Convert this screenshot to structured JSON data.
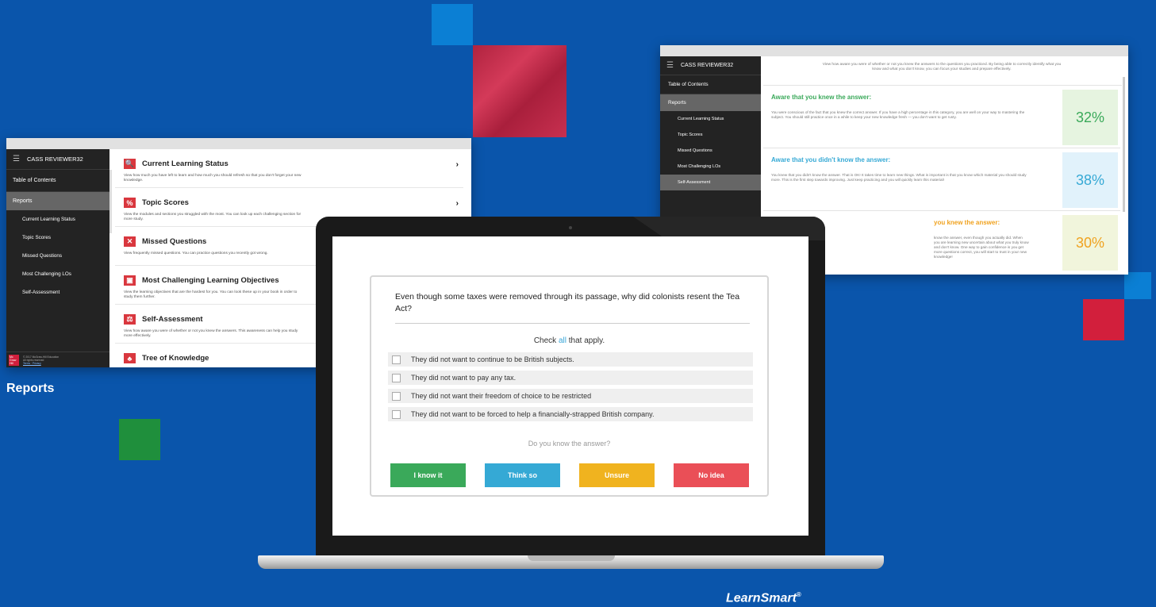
{
  "colors": {
    "background": "#0a55ab",
    "know_it": "#3aa95a",
    "think_so": "#35a9d5",
    "unsure": "#f0b31f",
    "no_idea": "#ea4f57",
    "icon_red": "#d9373e"
  },
  "left_screen": {
    "app_title": "CASS REVIEWER32",
    "sidebar": {
      "toc": "Table of Contents",
      "reports": "Reports",
      "items": [
        "Current Learning Status",
        "Topic Scores",
        "Missed Questions",
        "Most Challenging LOs",
        "Self-Assessment"
      ],
      "footer_lines": [
        "© 2017 McGraw-Hill Education",
        "All rights reserved"
      ],
      "footer_links": "Terms · Privacy",
      "logo_text": "Mc Graw Hill"
    },
    "reports": [
      {
        "icon": "search-icon",
        "glyph": "🔍",
        "title": "Current Learning Status",
        "desc": "View how much you have left to learn and how much you should refresh so that you don't forget your new knowledge."
      },
      {
        "icon": "percent-icon",
        "glyph": "%",
        "title": "Topic Scores",
        "desc": "View the modules and sections you struggled with the most. You can look up each challenging section for more study."
      },
      {
        "icon": "x-icon",
        "glyph": "✕",
        "title": "Missed Questions",
        "desc": "View frequently missed questions. You can practice questions you recently got wrong."
      },
      {
        "icon": "book-icon",
        "glyph": "▣",
        "title": "Most Challenging Learning Objectives",
        "desc": "View the learning objectives that are the hardest for you. You can look these up in your book in order to study them further."
      },
      {
        "icon": "scale-icon",
        "glyph": "⚖",
        "title": "Self-Assessment",
        "desc": "View how aware you were of whether or not you knew the answers. This awareness can help you study more effectively."
      },
      {
        "icon": "tree-icon",
        "glyph": "♣",
        "title": "Tree of Knowledge",
        "desc": ""
      }
    ]
  },
  "right_screen": {
    "app_title": "CASS REVIEWER32",
    "sidebar": {
      "toc": "Table of Contents",
      "reports": "Reports",
      "items": [
        "Current Learning Status",
        "Topic Scores",
        "Missed Questions",
        "Most Challenging LOs",
        "Self-Assessment"
      ]
    },
    "intro": "View how aware you were of whether or not you knew the answers to the questions you practiced. By being able to correctly identify what you know and what you don't know, you can focus your studies and prepare effectively.",
    "rows": [
      {
        "title": "Aware that you knew the answer:",
        "color": "#3aa95a",
        "bg": "#e6f4e0",
        "percent": "32%",
        "desc": "You were conscious of the fact that you knew the correct answer. If you have a high percentage in this category, you are well on your way to mastering the subject. You should still practice once in a while to keep your new knowledge fresh — you don't want to get rusty."
      },
      {
        "title": "Aware that you didn't know the answer:",
        "color": "#35a9d5",
        "bg": "#e1f2fb",
        "percent": "38%",
        "desc": "You knew that you didn't know the answer. That is OK! It takes time to learn new things. What is important is that you know which material you should study more. This is the first step towards improving. Just keep practicing and you will quickly learn this material!"
      },
      {
        "title": "you knew the answer:",
        "color": "#f0a21f",
        "bg": "#f1f5dc",
        "percent": "30%",
        "desc": "know the answer, even though you actually did. When you are learning new uncertain about what you truly know and don't know. One way to gain confidence is you get more questions correct, you will start to trust in your new knowledge!"
      }
    ]
  },
  "quiz": {
    "question": "Even though some taxes were removed through its passage, why did colonists resent the Tea Act?",
    "instruction_pre": "Check ",
    "instruction_highlight": "all",
    "instruction_post": " that apply.",
    "options": [
      "They did not want to continue to be British subjects.",
      "They did not want to pay any tax.",
      "They did not want their freedom of choice to be restricted",
      "They did not want to be forced to help a financially-strapped British company."
    ],
    "prompt": "Do you know the answer?",
    "buttons": {
      "know_it": "I know it",
      "think_so": "Think so",
      "unsure": "Unsure",
      "no_idea": "No idea"
    }
  },
  "labels": {
    "reports": "Reports",
    "learnsmart": "LearnSmart",
    "learnsmart_mark": "®"
  }
}
